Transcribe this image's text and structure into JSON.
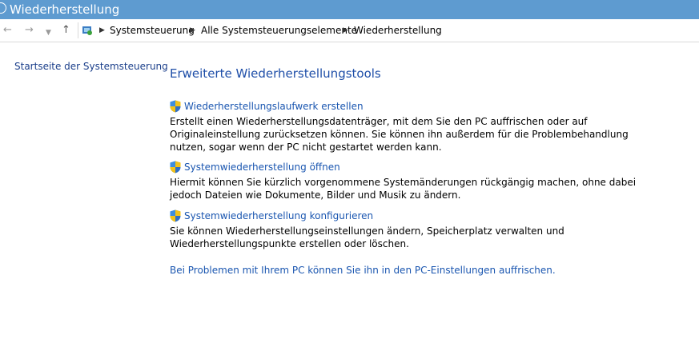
{
  "window": {
    "title": "Wiederherstellung"
  },
  "nav": {
    "back_icon": "back-arrow-icon",
    "forward_icon": "forward-arrow-icon",
    "recent_icon": "chevron-down-icon",
    "up_icon": "up-arrow-icon"
  },
  "breadcrumb": {
    "items": [
      "Systemsteuerung",
      "Alle Systemsteuerungselemente",
      "Wiederherstellung"
    ]
  },
  "sidebar": {
    "home_link": "Startseite der Systemsteuerung"
  },
  "main": {
    "heading": "Erweiterte Wiederherstellungstools",
    "tools": [
      {
        "label": "Wiederherstellungslaufwerk erstellen",
        "description": "Erstellt einen Wiederherstellungsdatenträger, mit dem Sie den PC auffrischen oder auf Originaleinstellung zurücksetzen können. Sie können ihn außerdem für die Problembehandlung nutzen, sogar wenn der PC nicht gestartet werden kann.",
        "icon": "uac-shield-icon"
      },
      {
        "label": "Systemwiederherstellung öffnen",
        "description": "Hiermit können Sie kürzlich vorgenommene Systemänderungen rückgängig machen, ohne dabei jedoch Dateien wie Dokumente, Bilder und Musik zu ändern.",
        "icon": "uac-shield-icon"
      },
      {
        "label": "Systemwiederherstellung konfigurieren",
        "description": "Sie können Wiederherstellungseinstellungen ändern, Speicherplatz verwalten und Wiederherstellungspunkte erstellen oder löschen.",
        "icon": "uac-shield-icon"
      }
    ],
    "bottom_link": "Bei Problemen mit Ihrem PC können Sie ihn in den PC-Einstellungen auffrischen."
  },
  "colors": {
    "titlebar": "#5e9bd0",
    "link": "#1a56b0",
    "heading": "#1e4ea8"
  }
}
